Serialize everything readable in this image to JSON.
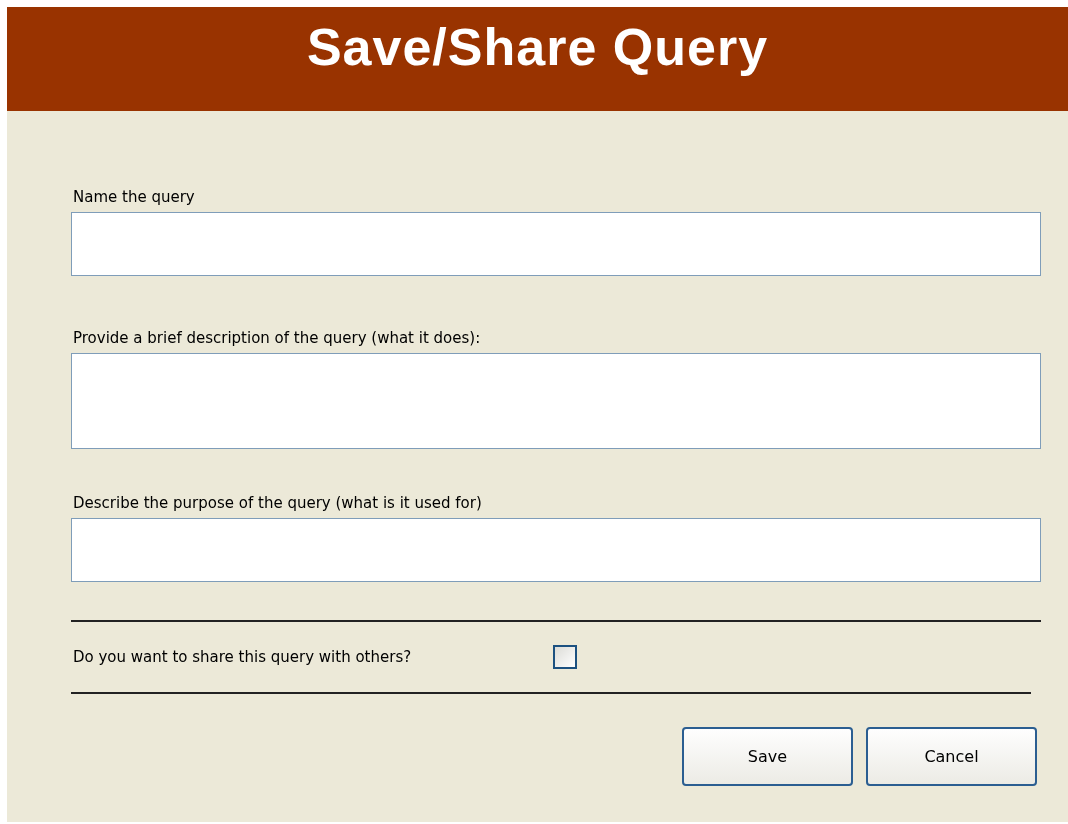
{
  "window": {
    "title": "Save/Share Query"
  },
  "fields": [
    {
      "label": "Name the query",
      "kind": "single"
    },
    {
      "label": "Provide a brief description of the query (what it does):",
      "kind": "multi"
    },
    {
      "label": "Describe the purpose of the query (what is it used for)",
      "kind": "single"
    }
  ],
  "share": {
    "label": "Do you want to share this query with others?",
    "checked": false
  },
  "buttons": [
    "Save",
    "Cancel"
  ]
}
